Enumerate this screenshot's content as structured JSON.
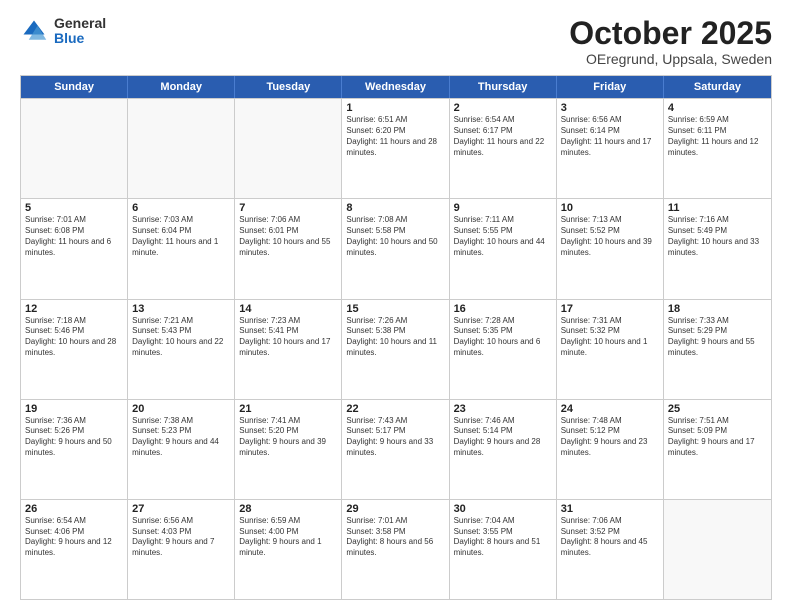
{
  "logo": {
    "general": "General",
    "blue": "Blue"
  },
  "header": {
    "title": "October 2025",
    "subtitle": "OEregrund, Uppsala, Sweden"
  },
  "weekdays": [
    "Sunday",
    "Monday",
    "Tuesday",
    "Wednesday",
    "Thursday",
    "Friday",
    "Saturday"
  ],
  "weeks": [
    [
      {
        "day": "",
        "sunrise": "",
        "sunset": "",
        "daylight": "",
        "empty": true
      },
      {
        "day": "",
        "sunrise": "",
        "sunset": "",
        "daylight": "",
        "empty": true
      },
      {
        "day": "",
        "sunrise": "",
        "sunset": "",
        "daylight": "",
        "empty": true
      },
      {
        "day": "1",
        "sunrise": "Sunrise: 6:51 AM",
        "sunset": "Sunset: 6:20 PM",
        "daylight": "Daylight: 11 hours and 28 minutes."
      },
      {
        "day": "2",
        "sunrise": "Sunrise: 6:54 AM",
        "sunset": "Sunset: 6:17 PM",
        "daylight": "Daylight: 11 hours and 22 minutes."
      },
      {
        "day": "3",
        "sunrise": "Sunrise: 6:56 AM",
        "sunset": "Sunset: 6:14 PM",
        "daylight": "Daylight: 11 hours and 17 minutes."
      },
      {
        "day": "4",
        "sunrise": "Sunrise: 6:59 AM",
        "sunset": "Sunset: 6:11 PM",
        "daylight": "Daylight: 11 hours and 12 minutes."
      }
    ],
    [
      {
        "day": "5",
        "sunrise": "Sunrise: 7:01 AM",
        "sunset": "Sunset: 6:08 PM",
        "daylight": "Daylight: 11 hours and 6 minutes."
      },
      {
        "day": "6",
        "sunrise": "Sunrise: 7:03 AM",
        "sunset": "Sunset: 6:04 PM",
        "daylight": "Daylight: 11 hours and 1 minute."
      },
      {
        "day": "7",
        "sunrise": "Sunrise: 7:06 AM",
        "sunset": "Sunset: 6:01 PM",
        "daylight": "Daylight: 10 hours and 55 minutes."
      },
      {
        "day": "8",
        "sunrise": "Sunrise: 7:08 AM",
        "sunset": "Sunset: 5:58 PM",
        "daylight": "Daylight: 10 hours and 50 minutes."
      },
      {
        "day": "9",
        "sunrise": "Sunrise: 7:11 AM",
        "sunset": "Sunset: 5:55 PM",
        "daylight": "Daylight: 10 hours and 44 minutes."
      },
      {
        "day": "10",
        "sunrise": "Sunrise: 7:13 AM",
        "sunset": "Sunset: 5:52 PM",
        "daylight": "Daylight: 10 hours and 39 minutes."
      },
      {
        "day": "11",
        "sunrise": "Sunrise: 7:16 AM",
        "sunset": "Sunset: 5:49 PM",
        "daylight": "Daylight: 10 hours and 33 minutes."
      }
    ],
    [
      {
        "day": "12",
        "sunrise": "Sunrise: 7:18 AM",
        "sunset": "Sunset: 5:46 PM",
        "daylight": "Daylight: 10 hours and 28 minutes."
      },
      {
        "day": "13",
        "sunrise": "Sunrise: 7:21 AM",
        "sunset": "Sunset: 5:43 PM",
        "daylight": "Daylight: 10 hours and 22 minutes."
      },
      {
        "day": "14",
        "sunrise": "Sunrise: 7:23 AM",
        "sunset": "Sunset: 5:41 PM",
        "daylight": "Daylight: 10 hours and 17 minutes."
      },
      {
        "day": "15",
        "sunrise": "Sunrise: 7:26 AM",
        "sunset": "Sunset: 5:38 PM",
        "daylight": "Daylight: 10 hours and 11 minutes."
      },
      {
        "day": "16",
        "sunrise": "Sunrise: 7:28 AM",
        "sunset": "Sunset: 5:35 PM",
        "daylight": "Daylight: 10 hours and 6 minutes."
      },
      {
        "day": "17",
        "sunrise": "Sunrise: 7:31 AM",
        "sunset": "Sunset: 5:32 PM",
        "daylight": "Daylight: 10 hours and 1 minute."
      },
      {
        "day": "18",
        "sunrise": "Sunrise: 7:33 AM",
        "sunset": "Sunset: 5:29 PM",
        "daylight": "Daylight: 9 hours and 55 minutes."
      }
    ],
    [
      {
        "day": "19",
        "sunrise": "Sunrise: 7:36 AM",
        "sunset": "Sunset: 5:26 PM",
        "daylight": "Daylight: 9 hours and 50 minutes."
      },
      {
        "day": "20",
        "sunrise": "Sunrise: 7:38 AM",
        "sunset": "Sunset: 5:23 PM",
        "daylight": "Daylight: 9 hours and 44 minutes."
      },
      {
        "day": "21",
        "sunrise": "Sunrise: 7:41 AM",
        "sunset": "Sunset: 5:20 PM",
        "daylight": "Daylight: 9 hours and 39 minutes."
      },
      {
        "day": "22",
        "sunrise": "Sunrise: 7:43 AM",
        "sunset": "Sunset: 5:17 PM",
        "daylight": "Daylight: 9 hours and 33 minutes."
      },
      {
        "day": "23",
        "sunrise": "Sunrise: 7:46 AM",
        "sunset": "Sunset: 5:14 PM",
        "daylight": "Daylight: 9 hours and 28 minutes."
      },
      {
        "day": "24",
        "sunrise": "Sunrise: 7:48 AM",
        "sunset": "Sunset: 5:12 PM",
        "daylight": "Daylight: 9 hours and 23 minutes."
      },
      {
        "day": "25",
        "sunrise": "Sunrise: 7:51 AM",
        "sunset": "Sunset: 5:09 PM",
        "daylight": "Daylight: 9 hours and 17 minutes."
      }
    ],
    [
      {
        "day": "26",
        "sunrise": "Sunrise: 6:54 AM",
        "sunset": "Sunset: 4:06 PM",
        "daylight": "Daylight: 9 hours and 12 minutes."
      },
      {
        "day": "27",
        "sunrise": "Sunrise: 6:56 AM",
        "sunset": "Sunset: 4:03 PM",
        "daylight": "Daylight: 9 hours and 7 minutes."
      },
      {
        "day": "28",
        "sunrise": "Sunrise: 6:59 AM",
        "sunset": "Sunset: 4:00 PM",
        "daylight": "Daylight: 9 hours and 1 minute."
      },
      {
        "day": "29",
        "sunrise": "Sunrise: 7:01 AM",
        "sunset": "Sunset: 3:58 PM",
        "daylight": "Daylight: 8 hours and 56 minutes."
      },
      {
        "day": "30",
        "sunrise": "Sunrise: 7:04 AM",
        "sunset": "Sunset: 3:55 PM",
        "daylight": "Daylight: 8 hours and 51 minutes."
      },
      {
        "day": "31",
        "sunrise": "Sunrise: 7:06 AM",
        "sunset": "Sunset: 3:52 PM",
        "daylight": "Daylight: 8 hours and 45 minutes."
      },
      {
        "day": "",
        "sunrise": "",
        "sunset": "",
        "daylight": "",
        "empty": true
      }
    ]
  ]
}
